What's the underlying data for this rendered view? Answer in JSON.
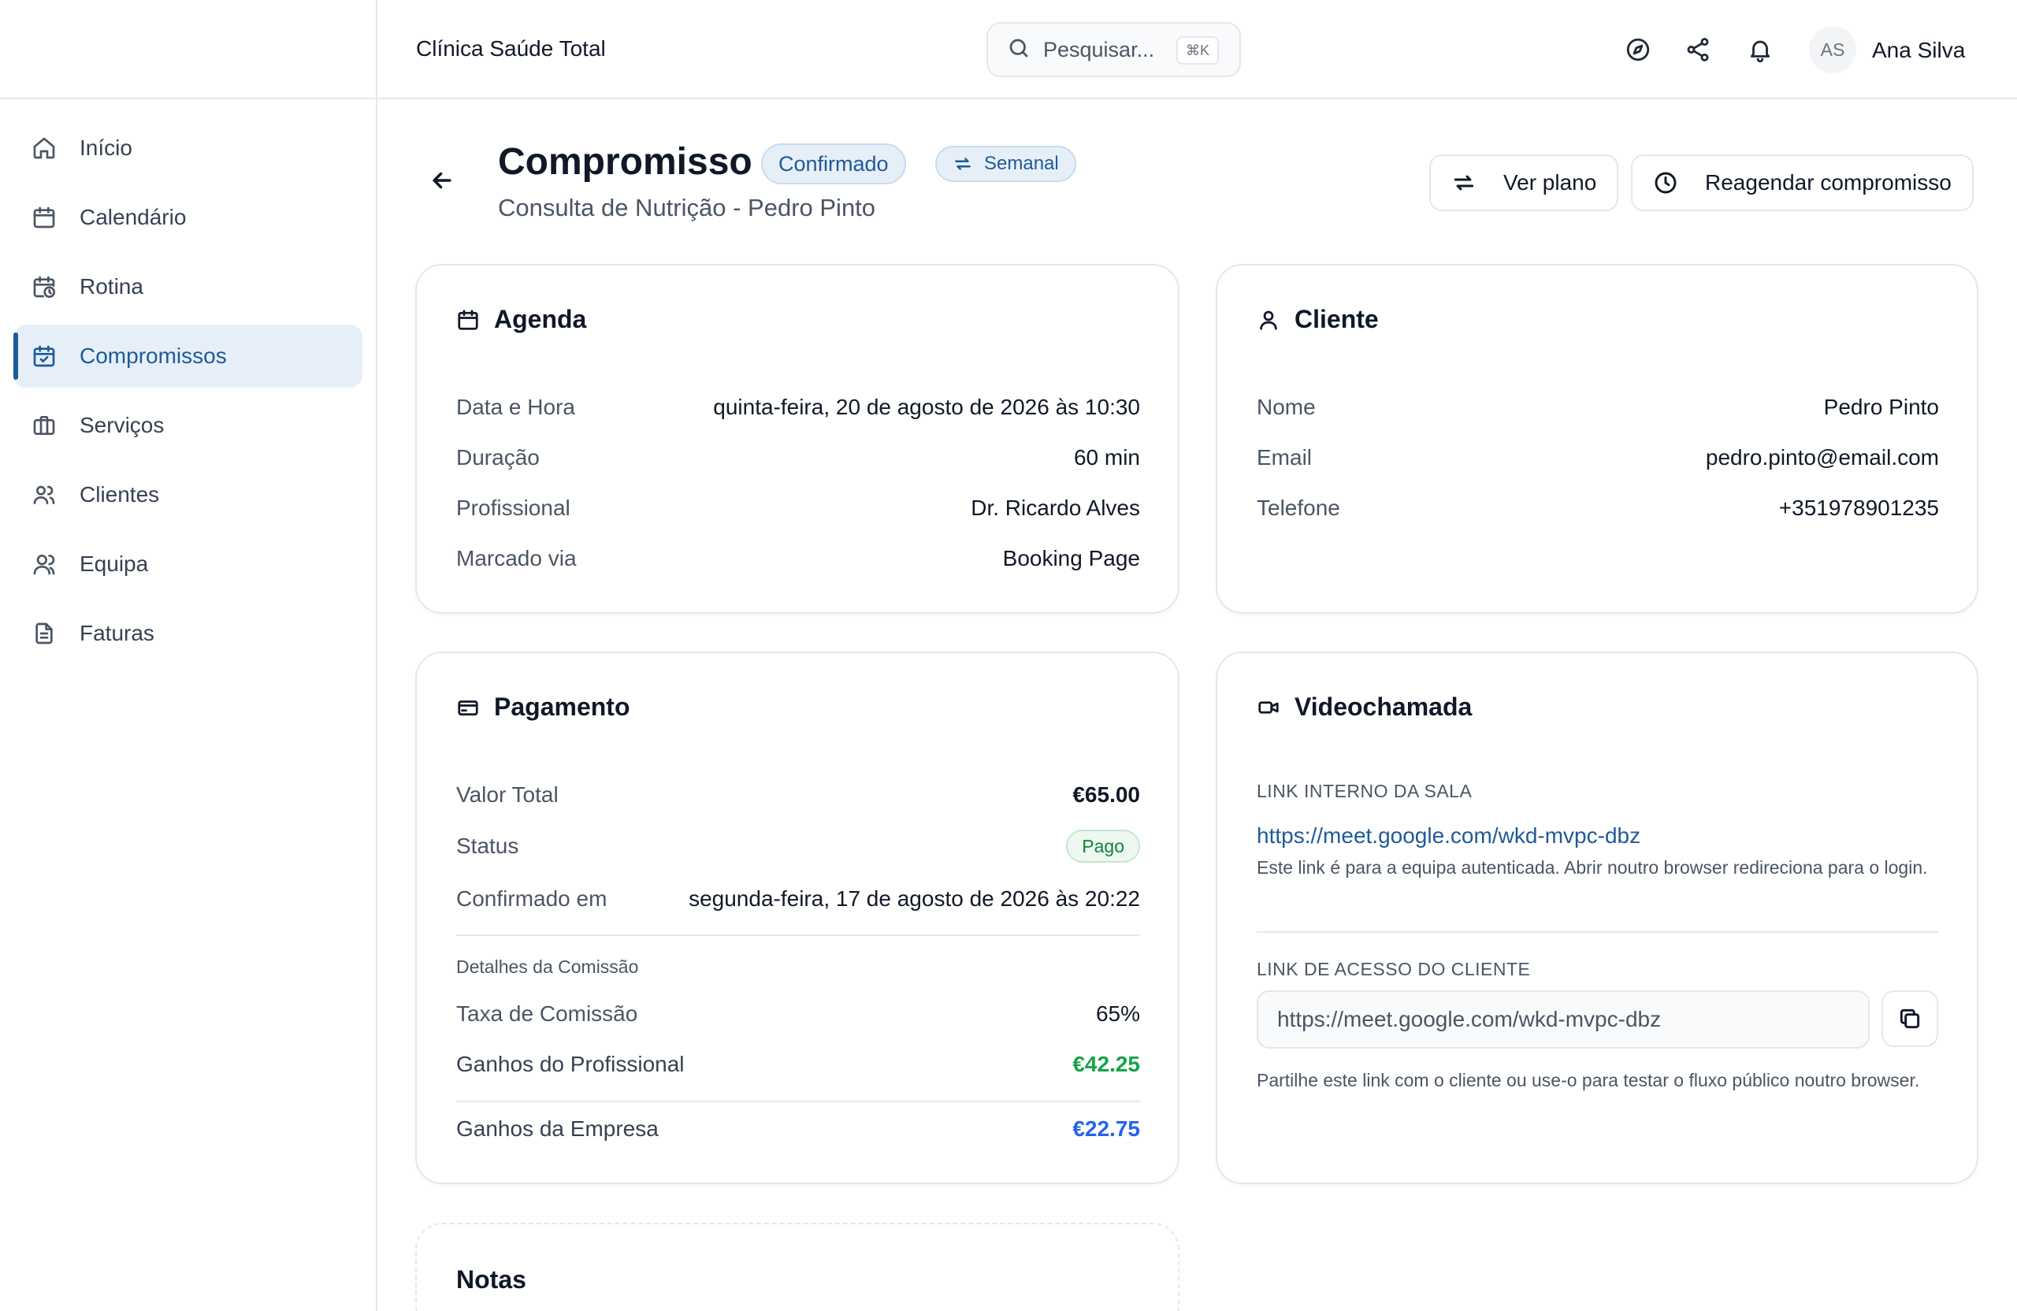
{
  "topbar": {
    "clinic_name": "Clínica Saúde Total",
    "search_placeholder": "Pesquisar...",
    "search_shortcut": "⌘K",
    "user_initials": "AS",
    "user_name": "Ana Silva"
  },
  "sidebar": {
    "items": [
      {
        "label": "Início",
        "icon": "home-icon",
        "active": false
      },
      {
        "label": "Calendário",
        "icon": "calendar-icon",
        "active": false
      },
      {
        "label": "Rotina",
        "icon": "calendar-clock-icon",
        "active": false
      },
      {
        "label": "Compromissos",
        "icon": "calendar-check-icon",
        "active": true
      },
      {
        "label": "Serviços",
        "icon": "briefcase-icon",
        "active": false
      },
      {
        "label": "Clientes",
        "icon": "users-icon",
        "active": false
      },
      {
        "label": "Equipa",
        "icon": "user-group-icon",
        "active": false
      },
      {
        "label": "Faturas",
        "icon": "document-icon",
        "active": false
      }
    ]
  },
  "header": {
    "title": "Compromisso",
    "status_badge": "Confirmado",
    "recurrence_badge": "Semanal",
    "subtitle": "Consulta de Nutrição - Pedro Pinto",
    "view_plan_label": "Ver plano",
    "reschedule_label": "Reagendar compromisso"
  },
  "agenda": {
    "title": "Agenda",
    "rows": [
      {
        "label": "Data e Hora",
        "value": "quinta-feira, 20 de agosto de 2026 às 10:30"
      },
      {
        "label": "Duração",
        "value": "60 min"
      },
      {
        "label": "Profissional",
        "value": "Dr. Ricardo Alves"
      },
      {
        "label": "Marcado via",
        "value": "Booking Page"
      }
    ]
  },
  "client": {
    "title": "Cliente",
    "rows": [
      {
        "label": "Nome",
        "value": "Pedro Pinto"
      },
      {
        "label": "Email",
        "value": "pedro.pinto@email.com"
      },
      {
        "label": "Telefone",
        "value": "+351978901235"
      }
    ]
  },
  "payment": {
    "title": "Pagamento",
    "total_label": "Valor Total",
    "total_value": "€65.00",
    "status_label": "Status",
    "status_value": "Pago",
    "confirmed_label": "Confirmado em",
    "confirmed_value": "segunda-feira, 17 de agosto de 2026 às 20:22",
    "commission_heading": "Detalhes da Comissão",
    "commission_rate_label": "Taxa de Comissão",
    "commission_rate_value": "65%",
    "professional_earnings_label": "Ganhos do Profissional",
    "professional_earnings_value": "€42.25",
    "company_earnings_label": "Ganhos da Empresa",
    "company_earnings_value": "€22.75"
  },
  "video": {
    "title": "Videochamada",
    "internal_label": "LINK INTERNO DA SALA",
    "internal_link": "https://meet.google.com/wkd-mvpc-dbz",
    "internal_help": "Este link é para a equipa autenticada. Abrir noutro browser redireciona para o login.",
    "client_label": "LINK DE ACESSO DO CLIENTE",
    "client_link": "https://meet.google.com/wkd-mvpc-dbz",
    "client_help": "Partilhe este link com o cliente ou use-o para testar o fluxo público noutro browser."
  },
  "notes": {
    "title": "Notas"
  },
  "colors": {
    "accent": "#1e5a99",
    "accent_bg": "#e6eff8",
    "paid_green": "#15803d",
    "earnings_green": "#16a34a",
    "earnings_blue": "#2563eb"
  }
}
